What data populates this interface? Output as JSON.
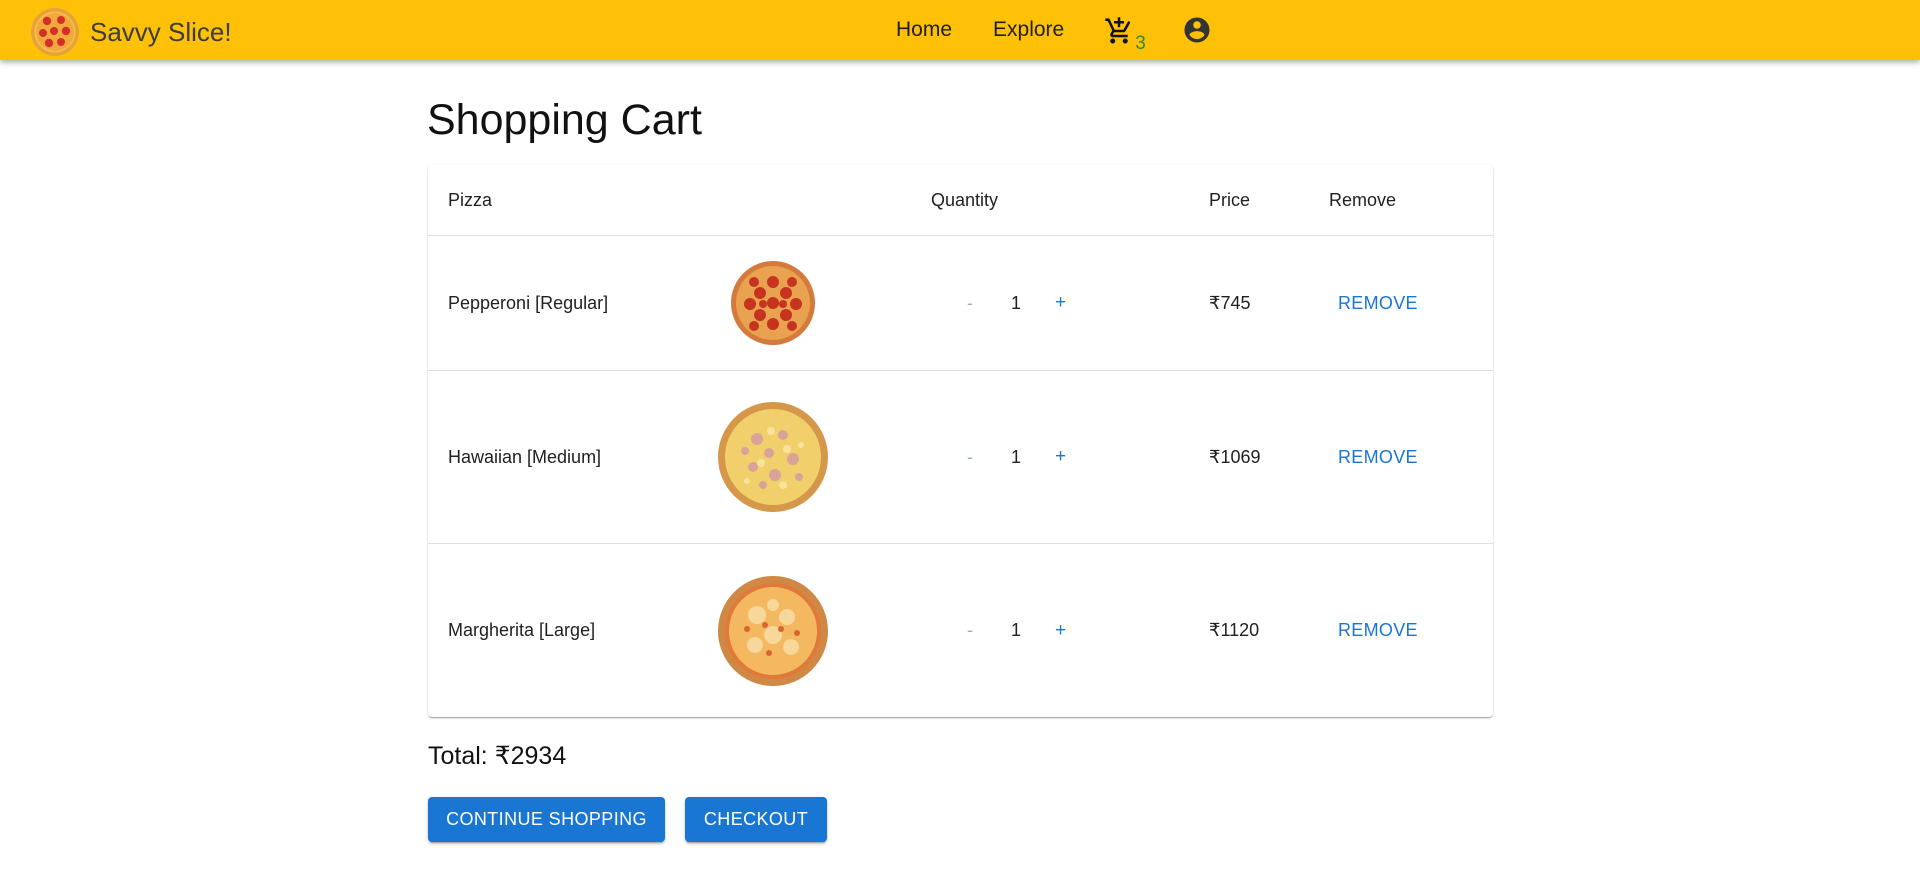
{
  "header": {
    "brand_name": "Savvy Slice!",
    "nav": {
      "home": "Home",
      "explore": "Explore"
    },
    "cart_count": "3",
    "accent_color": "#ffc107",
    "icons": {
      "logo": "pizza-logo-icon",
      "cart": "cart-icon",
      "account": "account-circle-icon"
    }
  },
  "main": {
    "title": "Shopping Cart",
    "table": {
      "headers": {
        "pizza": "Pizza",
        "quantity": "Quantity",
        "price": "Price",
        "remove": "Remove"
      },
      "rows": [
        {
          "name": "Pepperoni [Regular]",
          "image": "pepperoni-pizza-image",
          "minus": "-",
          "qty": "1",
          "plus": "+",
          "price": "₹745",
          "remove": "REMOVE"
        },
        {
          "name": "Hawaiian [Medium]",
          "image": "hawaiian-pizza-image",
          "minus": "-",
          "qty": "1",
          "plus": "+",
          "price": "₹1069",
          "remove": "REMOVE"
        },
        {
          "name": "Margherita [Large]",
          "image": "margherita-pizza-image",
          "minus": "-",
          "qty": "1",
          "plus": "+",
          "price": "₹1120",
          "remove": "REMOVE"
        }
      ]
    },
    "total": "Total: ₹2934",
    "buttons": {
      "continue": "CONTINUE SHOPPING",
      "checkout": "CHECKOUT"
    },
    "button_color": "#1976d2"
  }
}
